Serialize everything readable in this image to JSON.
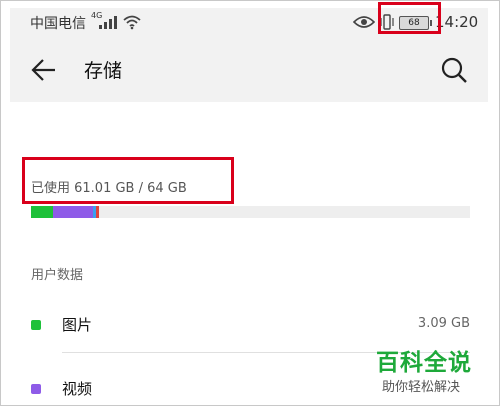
{
  "status_bar": {
    "carrier": "中国电信",
    "network_type": "4G",
    "battery": "68",
    "time": "14:20",
    "icons": [
      "signal-icon",
      "wifi-icon",
      "eye-icon",
      "vibrate-icon",
      "battery-icon"
    ]
  },
  "toolbar": {
    "title": "存储",
    "back_icon": "arrow-left-icon",
    "search_icon": "search-icon"
  },
  "storage": {
    "used_label": "已使用 61.01 GB / 64 GB",
    "used_fraction": 0.953,
    "segments": [
      {
        "name": "images",
        "color": "#1ec13a",
        "fraction": 0.05
      },
      {
        "name": "videos",
        "color": "#8e5be8",
        "fraction": 0.09
      },
      {
        "name": "audio",
        "color": "#3aa0f0",
        "fraction": 0.007
      },
      {
        "name": "other",
        "color": "#e0443e",
        "fraction": 0.007
      }
    ]
  },
  "user_data": {
    "header": "用户数据",
    "items": [
      {
        "label": "图片",
        "size": "3.09 GB",
        "color": "#1ec13a"
      },
      {
        "label": "视频",
        "size": "",
        "color": "#8e5be8"
      }
    ]
  },
  "watermark": {
    "title": "百科全说",
    "subtitle": "助你轻松解决"
  },
  "colors": {
    "highlight": "#d9001b",
    "header_bg": "#f2f2f2"
  }
}
